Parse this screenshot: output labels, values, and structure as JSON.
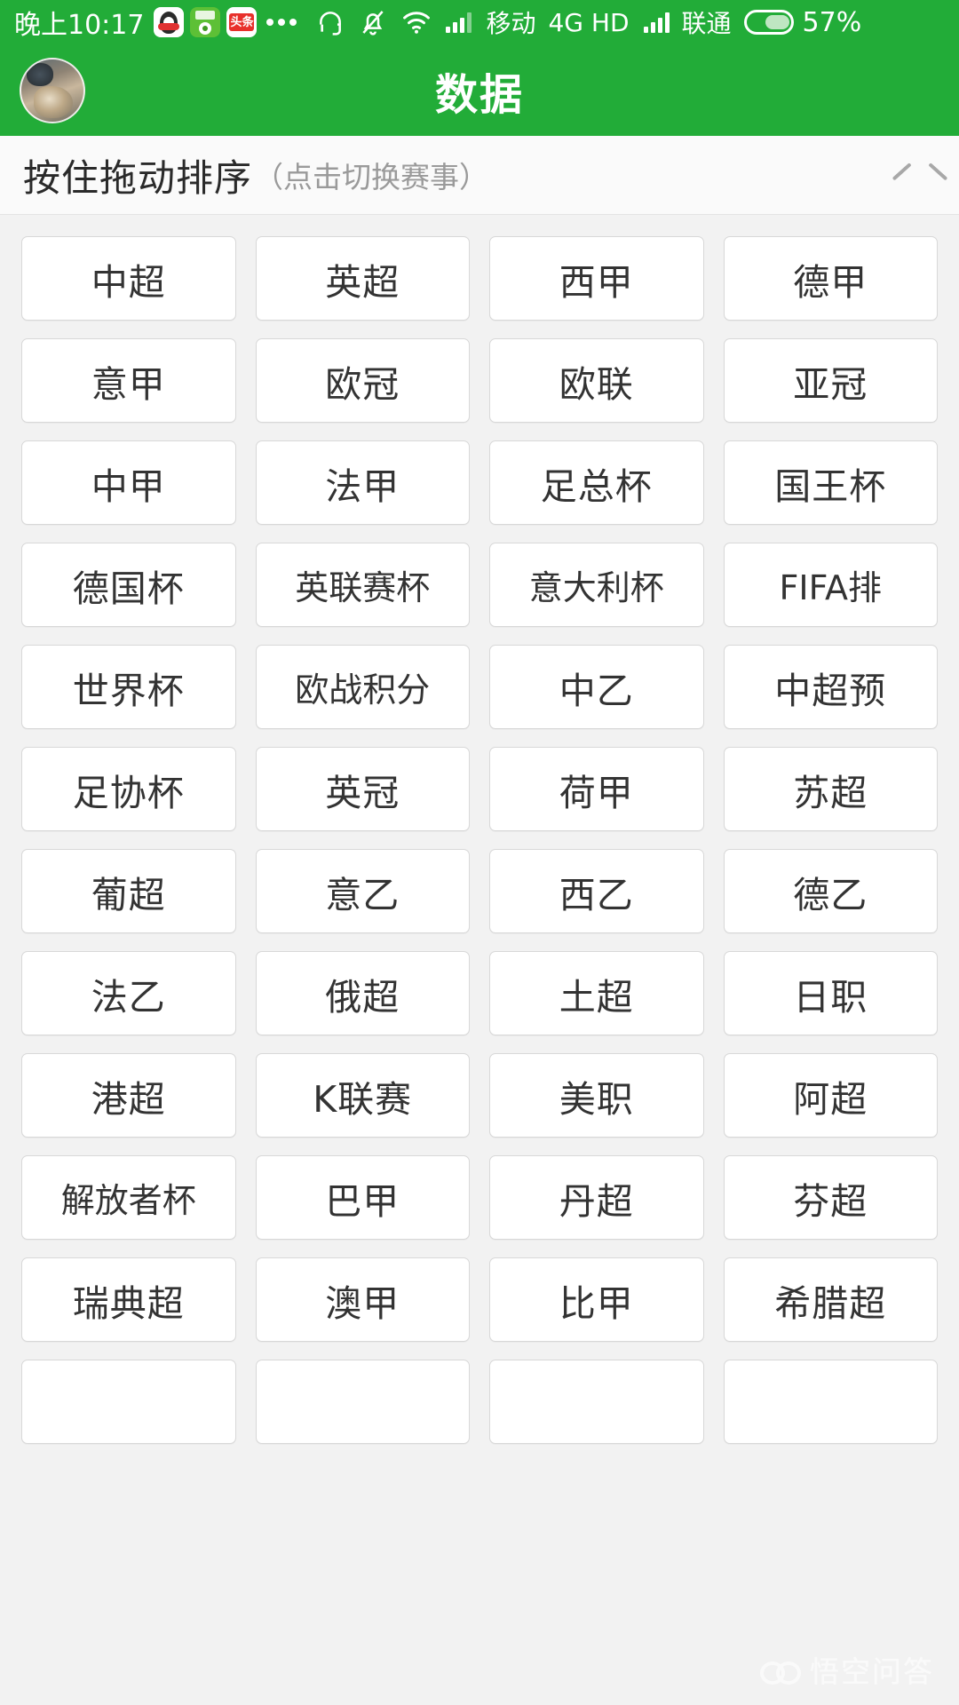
{
  "status_bar": {
    "clock": "晚上10:17",
    "app_icons": [
      "qq-icon",
      "football-app-icon",
      "toutiao-icon"
    ],
    "overflow_dots": "•••",
    "icons": [
      "headset-icon",
      "bell-muted-icon",
      "wifi-icon"
    ],
    "carrier_1": "移动",
    "network": "4G HD",
    "carrier_2": "联通",
    "battery_text": "57%",
    "battery_percent": 57,
    "toutiao_label": "头条"
  },
  "header": {
    "title": "数据",
    "avatar": "user-avatar"
  },
  "sort_bar": {
    "main_text": "按住拖动排序",
    "sub_text": "（点击切换赛事）",
    "collapse_icon": "chevron-up-icon"
  },
  "grid": {
    "columns": 4,
    "items": [
      "中超",
      "英超",
      "西甲",
      "德甲",
      "意甲",
      "欧冠",
      "欧联",
      "亚冠",
      "中甲",
      "法甲",
      "足总杯",
      "国王杯",
      "德国杯",
      "英联赛杯",
      "意大利杯",
      "FIFA排",
      "世界杯",
      "欧战积分",
      "中乙",
      "中超预",
      "足协杯",
      "英冠",
      "荷甲",
      "苏超",
      "葡超",
      "意乙",
      "西乙",
      "德乙",
      "法乙",
      "俄超",
      "土超",
      "日职",
      "港超",
      "K联赛",
      "美职",
      "阿超",
      "解放者杯",
      "巴甲",
      "丹超",
      "芬超",
      "瑞典超",
      "澳甲",
      "比甲",
      "希腊超",
      "",
      "",
      "",
      ""
    ]
  },
  "watermark": {
    "text": "悟空问答",
    "logo": "wukong-logo"
  },
  "colors": {
    "brand_green": "#22ac38",
    "page_background": "#f2f2f2",
    "cell_background": "#ffffff",
    "cell_border": "#d8d8d8",
    "text_primary": "#333333",
    "text_muted": "#9a9a9a"
  }
}
